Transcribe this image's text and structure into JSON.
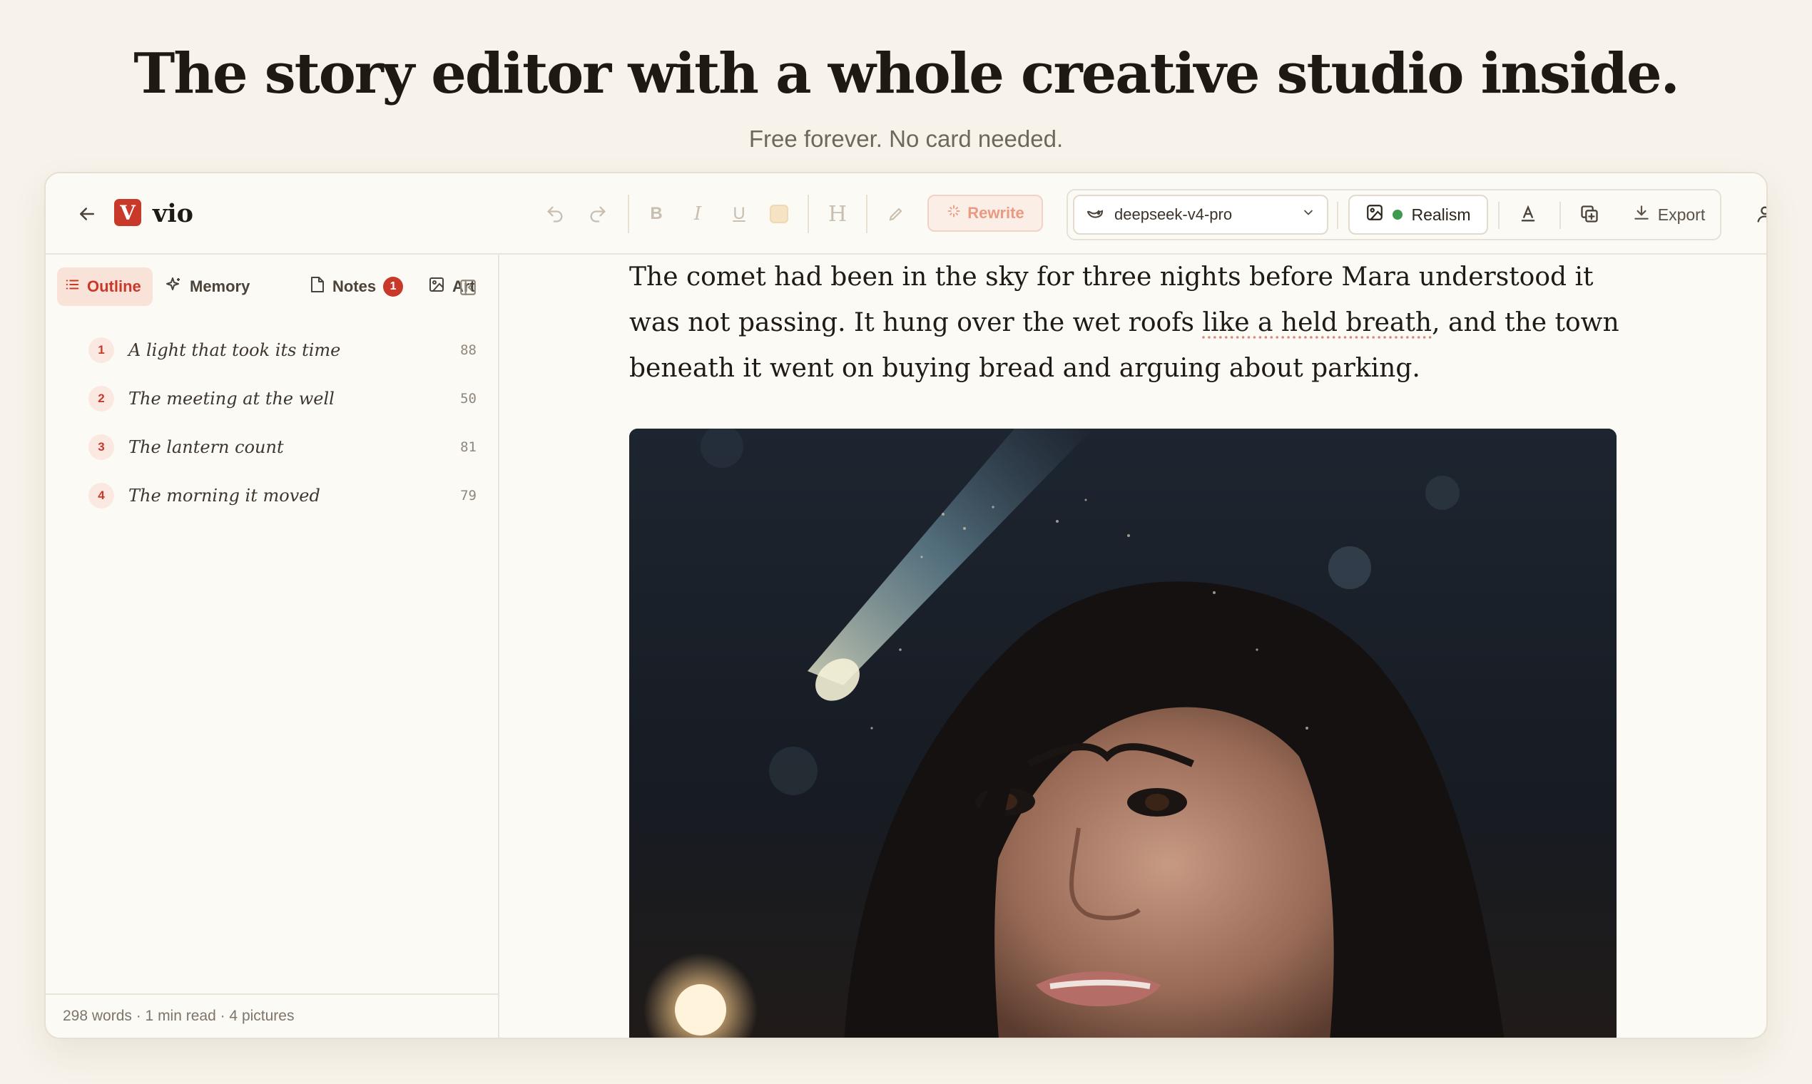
{
  "hero": {
    "title": "The story editor with a whole creative studio inside.",
    "subtitle": "Free forever. No card needed."
  },
  "app": {
    "logo_letter": "V",
    "name": "vio"
  },
  "toolbar": {
    "format_buttons": [
      "B",
      "I",
      "U",
      "H"
    ],
    "rewrite_label": "Rewrite",
    "model": "deepseek-v4-pro",
    "style_label": "Realism",
    "export_label": "Export"
  },
  "sidebar": {
    "tabs": [
      {
        "label": "Outline",
        "icon": "list-icon",
        "active": true
      },
      {
        "label": "Memory",
        "icon": "sparkle-icon"
      },
      {
        "label": "Notes",
        "icon": "note-icon",
        "badge": "1"
      },
      {
        "label": "Art",
        "icon": "image-icon"
      }
    ],
    "outline": [
      {
        "num": "1",
        "title": "A light that took its time",
        "count": "88"
      },
      {
        "num": "2",
        "title": "The meeting at the well",
        "count": "50"
      },
      {
        "num": "3",
        "title": "The lantern count",
        "count": "81"
      },
      {
        "num": "4",
        "title": "The morning it moved",
        "count": "79"
      }
    ],
    "footer": "298 words · 1 min read · 4 pictures"
  },
  "editor": {
    "text_before": "The comet had been in the sky for three nights before Mara understood it was not passing. It hung over the wet roofs ",
    "text_highlight": "like a held breath",
    "text_after": ", and the town beneath it went on buying bread and arguing about parking."
  },
  "colors": {
    "accent": "#c9392a",
    "background": "#f7f3ea",
    "status_green": "#3e9a4d"
  }
}
